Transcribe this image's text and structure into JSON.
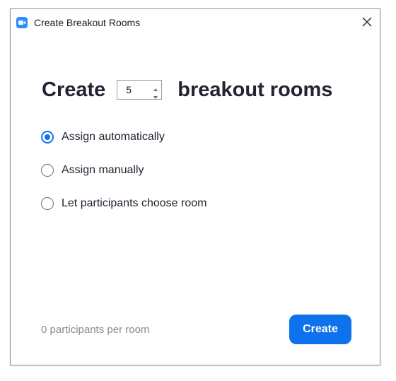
{
  "window": {
    "title": "Create Breakout Rooms",
    "app_icon": "zoom-camera-icon",
    "close_icon": "close-icon"
  },
  "heading": {
    "prefix": "Create",
    "rooms_count": "5",
    "suffix": "breakout rooms"
  },
  "options": [
    {
      "label": "Assign automatically",
      "selected": true
    },
    {
      "label": "Assign manually",
      "selected": false
    },
    {
      "label": "Let participants choose room",
      "selected": false
    }
  ],
  "footer": {
    "participants_text": "0 participants per room",
    "create_label": "Create"
  },
  "colors": {
    "accent": "#0e72ed",
    "app_icon_bg": "#2d8cff",
    "text": "#232333",
    "muted_text": "#8a8a8a"
  }
}
